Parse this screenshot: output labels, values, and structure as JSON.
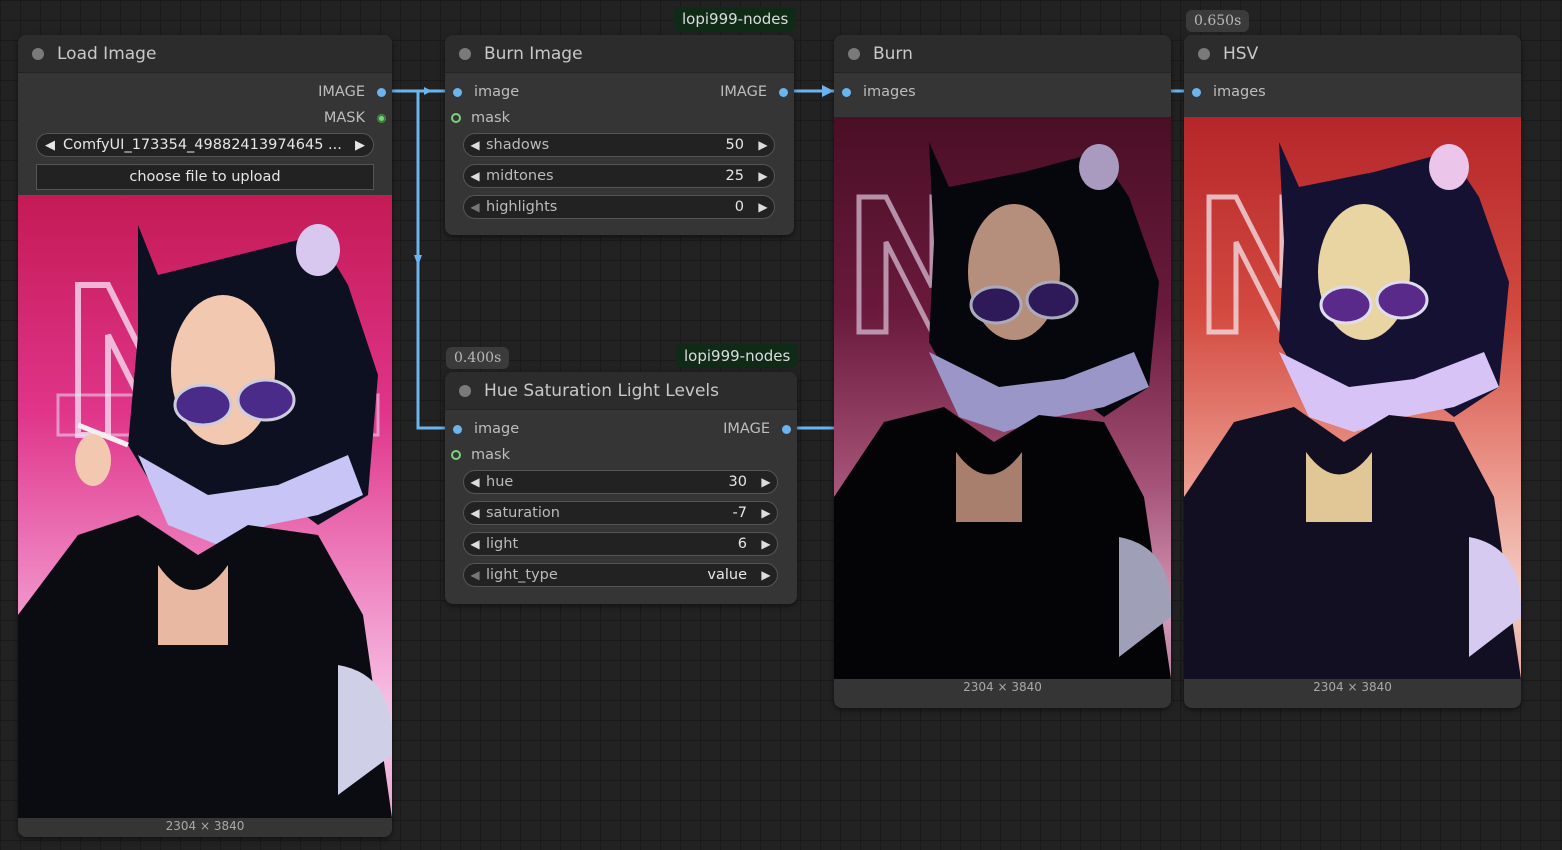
{
  "badges": {
    "burn_image_source": "lopi999-nodes",
    "hsl_source": "lopi999-nodes",
    "hsl_time": "0.400s",
    "hsv_time": "0.650s"
  },
  "load_image": {
    "title": "Load Image",
    "out_image": "IMAGE",
    "out_mask": "MASK",
    "file": "ComfyUI_173354_49882413974645 ...",
    "upload": "choose file to upload",
    "dims": "2304 × 3840"
  },
  "burn_image": {
    "title": "Burn Image",
    "in_image": "image",
    "in_mask": "mask",
    "out_image": "IMAGE",
    "widgets": [
      {
        "label": "shadows",
        "value": "50"
      },
      {
        "label": "midtones",
        "value": "25"
      },
      {
        "label": "highlights",
        "value": "0"
      }
    ]
  },
  "hsl": {
    "title": "Hue Saturation Light Levels",
    "in_image": "image",
    "in_mask": "mask",
    "out_image": "IMAGE",
    "widgets": [
      {
        "label": "hue",
        "value": "30"
      },
      {
        "label": "saturation",
        "value": "-7"
      },
      {
        "label": "light",
        "value": "6"
      },
      {
        "label": "light_type",
        "value": "value"
      }
    ]
  },
  "burn_preview": {
    "title": "Burn",
    "in_images": "images",
    "dims": "2304 × 3840"
  },
  "hsv_preview": {
    "title": "HSV",
    "in_images": "images",
    "dims": "2304 × 3840"
  },
  "colors": {
    "wire": "#6cb4ee",
    "node_bg": "#353535",
    "title_bg": "#2c2c2c",
    "canvas": "#222222"
  }
}
